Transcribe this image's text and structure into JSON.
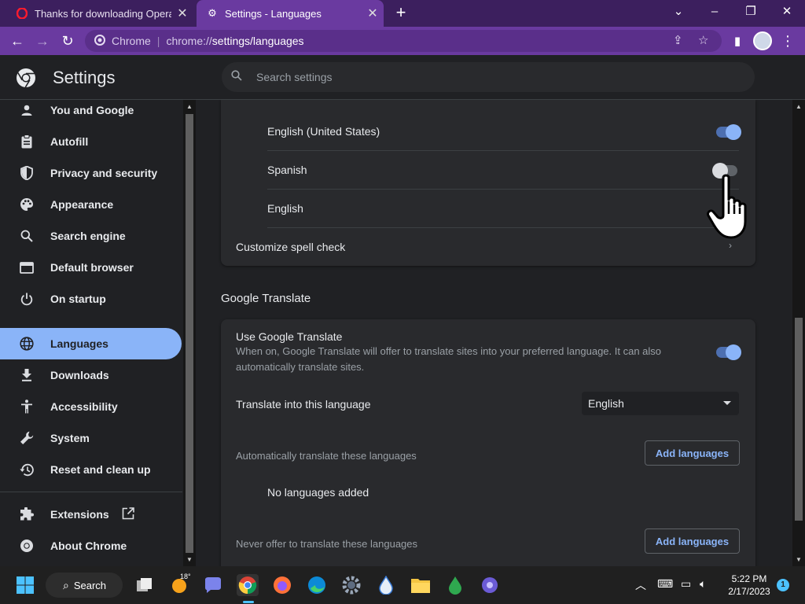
{
  "tabs": [
    {
      "title": "Thanks for downloading Opera",
      "active": false
    },
    {
      "title": "Settings - Languages",
      "active": true
    }
  ],
  "omnibox": {
    "site_label": "Chrome",
    "url_prefix": "chrome://",
    "url_path": "settings/languages"
  },
  "header": {
    "title": "Settings",
    "search_placeholder": "Search settings"
  },
  "sidebar": {
    "items": [
      {
        "label": "You and Google",
        "icon": "person-icon"
      },
      {
        "label": "Autofill",
        "icon": "clipboard-icon"
      },
      {
        "label": "Privacy and security",
        "icon": "shield-icon"
      },
      {
        "label": "Appearance",
        "icon": "palette-icon"
      },
      {
        "label": "Search engine",
        "icon": "search-icon"
      },
      {
        "label": "Default browser",
        "icon": "browser-window-icon"
      },
      {
        "label": "On startup",
        "icon": "power-icon"
      },
      {
        "label": "Languages",
        "icon": "globe-icon",
        "active": true
      },
      {
        "label": "Downloads",
        "icon": "download-icon"
      },
      {
        "label": "Accessibility",
        "icon": "accessibility-icon"
      },
      {
        "label": "System",
        "icon": "wrench-icon"
      },
      {
        "label": "Reset and clean up",
        "icon": "history-icon"
      }
    ],
    "extensions_label": "Extensions",
    "about_label": "About Chrome"
  },
  "spellcheck": {
    "languages": [
      {
        "label": "English (United States)",
        "enabled": true
      },
      {
        "label": "Spanish",
        "enabled": false
      },
      {
        "label": "English",
        "enabled": false
      }
    ],
    "customize_label": "Customize spell check"
  },
  "translate": {
    "section_title": "Google Translate",
    "use_label": "Use Google Translate",
    "use_desc_line1": "When on, Google Translate will offer to translate sites into your preferred language. It can also",
    "use_desc_line2": "automatically translate sites.",
    "use_enabled": true,
    "into_label": "Translate into this language",
    "into_value": "English",
    "auto_label": "Automatically translate these languages",
    "add_languages_label": "Add languages",
    "no_languages_label": "No languages added",
    "never_label": "Never offer to translate these languages"
  },
  "taskbar": {
    "search_label": "Search",
    "weather_temp": "18°",
    "time": "5:22 PM",
    "date": "2/17/2023",
    "notification_count": "1"
  },
  "colors": {
    "accent": "#8ab4f8",
    "titlebar": "#3c1f5e",
    "toolbar": "#6a3aa0",
    "background": "#202124",
    "card": "#292a2d"
  }
}
